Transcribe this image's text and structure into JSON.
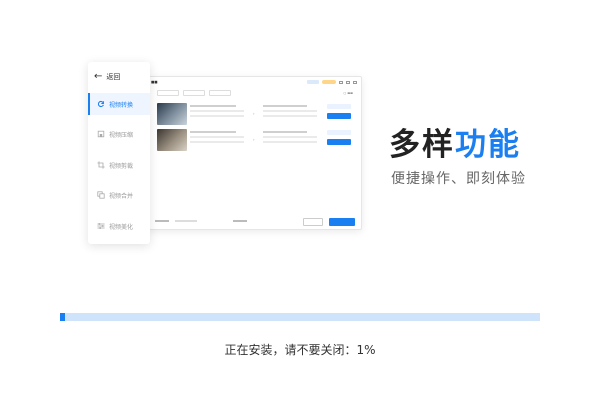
{
  "sidebar": {
    "back_label": "返回",
    "items": [
      {
        "label": "视频转换",
        "icon": "refresh-icon",
        "active": true
      },
      {
        "label": "视频压缩",
        "icon": "compress-icon",
        "active": false
      },
      {
        "label": "视频剪裁",
        "icon": "crop-icon",
        "active": false
      },
      {
        "label": "视频合并",
        "icon": "merge-icon",
        "active": false
      },
      {
        "label": "视频美化",
        "icon": "sliders-icon",
        "active": false
      }
    ]
  },
  "headline": {
    "part1": "多样",
    "part2": "功能",
    "subtitle": "便捷操作、即刻体验"
  },
  "progress": {
    "percent": 1,
    "status": "正在安装，请不要关闭：1%"
  },
  "colors": {
    "accent": "#1a7ff0",
    "track": "#cfe4fb"
  }
}
